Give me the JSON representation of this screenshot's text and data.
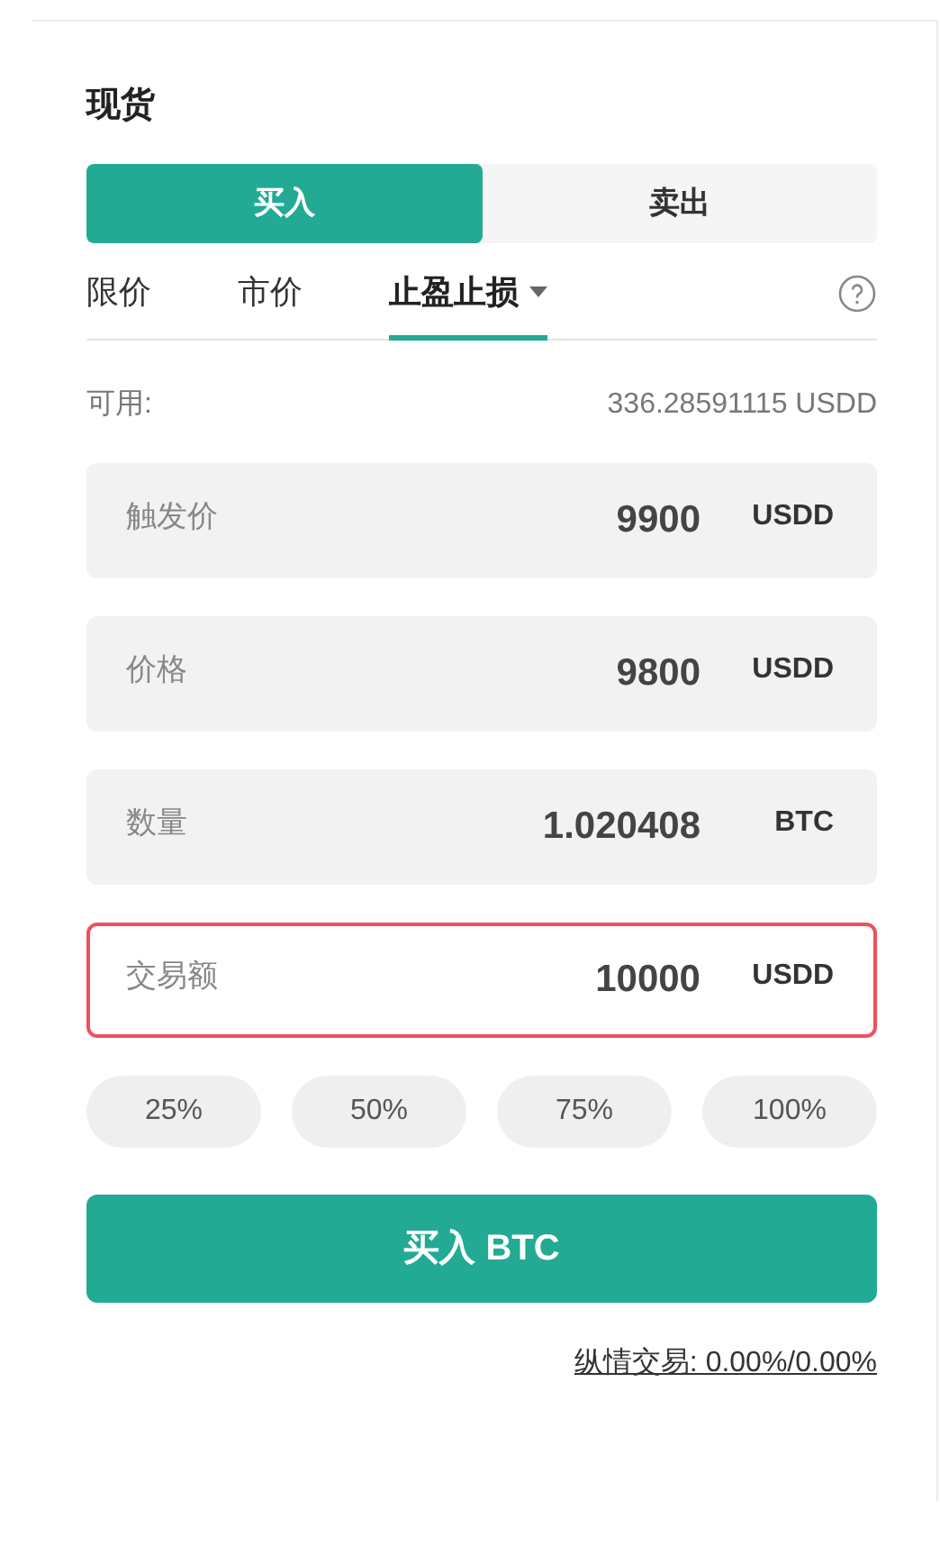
{
  "title": "现货",
  "sides": [
    {
      "label": "买入",
      "selected": true
    },
    {
      "label": "卖出",
      "selected": false
    }
  ],
  "order_types": [
    {
      "label": "限价",
      "selected": false,
      "dropdown": false
    },
    {
      "label": "市价",
      "selected": false,
      "dropdown": false
    },
    {
      "label": "止盈止损",
      "selected": true,
      "dropdown": true
    }
  ],
  "available": {
    "label": "可用:",
    "value": "336.28591115 USDD"
  },
  "fields": [
    {
      "label": "触发价",
      "value": "9900",
      "unit": "USDD",
      "error": false
    },
    {
      "label": "价格",
      "value": "9800",
      "unit": "USDD",
      "error": false
    },
    {
      "label": "数量",
      "value": "1.020408",
      "unit": "BTC",
      "error": false
    },
    {
      "label": "交易额",
      "value": "10000",
      "unit": "USDD",
      "error": true
    }
  ],
  "percent_buttons": [
    "25%",
    "50%",
    "75%",
    "100%"
  ],
  "submit": "买入 BTC",
  "fee_link": "纵情交易: 0.00%/0.00%"
}
